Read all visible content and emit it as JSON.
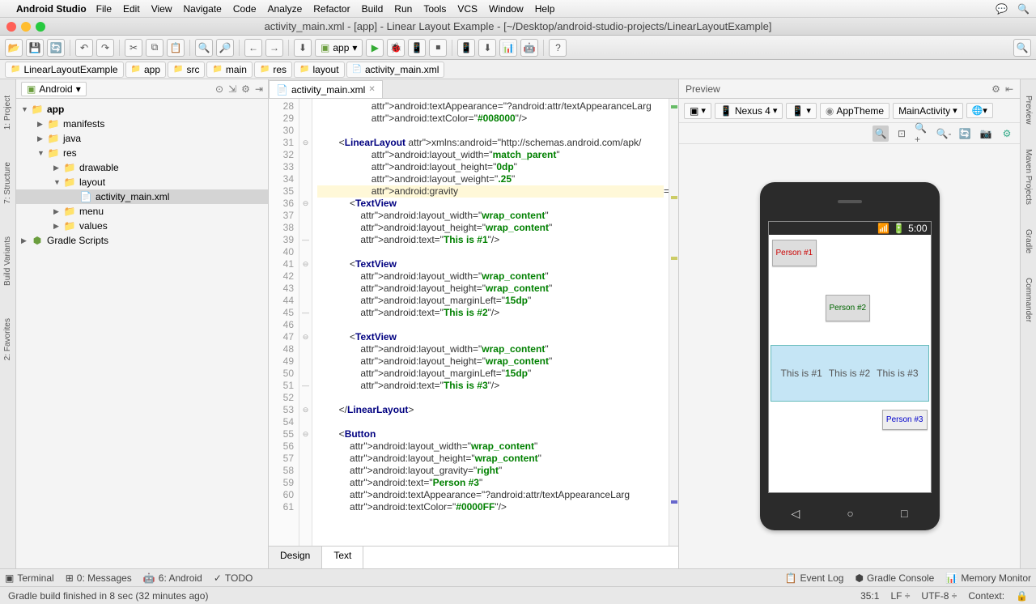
{
  "menubar": {
    "app_name": "Android Studio",
    "items": [
      "File",
      "Edit",
      "View",
      "Navigate",
      "Code",
      "Analyze",
      "Refactor",
      "Build",
      "Run",
      "Tools",
      "VCS",
      "Window",
      "Help"
    ]
  },
  "window": {
    "title": "activity_main.xml - [app] - Linear Layout Example - [~/Desktop/android-studio-projects/LinearLayoutExample]"
  },
  "run_config": {
    "label": "app"
  },
  "breadcrumbs": [
    "LinearLayoutExample",
    "app",
    "src",
    "main",
    "res",
    "layout",
    "activity_main.xml"
  ],
  "project": {
    "view_label": "Android",
    "tree": {
      "app": "app",
      "manifests": "manifests",
      "java": "java",
      "res": "res",
      "drawable": "drawable",
      "layout": "layout",
      "activity_main": "activity_main.xml",
      "menu": "menu",
      "values": "values",
      "gradle_scripts": "Gradle Scripts"
    }
  },
  "sidebar_left": {
    "project": "1: Project",
    "structure": "7: Structure",
    "build_variants": "Build Variants",
    "favorites": "2: Favorites"
  },
  "sidebar_right": {
    "preview": "Preview",
    "maven": "Maven Projects",
    "gradle": "Gradle",
    "commander": "Commander"
  },
  "editor": {
    "tab_label": "activity_main.xml",
    "first_line": 28,
    "lines": [
      "                    android:textAppearance=\"?android:attr/textAppearanceLarg",
      "                    android:textColor=\"#008000\"/>",
      "",
      "        <LinearLayout xmlns:android=\"http://schemas.android.com/apk/",
      "                    android:layout_width=\"match_parent\"",
      "                    android:layout_height=\"0dp\"",
      "                    android:layout_weight=\".25\"",
      "                    android:gravity=\"center\">",
      "            <TextView",
      "                android:layout_width=\"wrap_content\"",
      "                android:layout_height=\"wrap_content\"",
      "                android:text=\"This is #1\"/>",
      "",
      "            <TextView",
      "                android:layout_width=\"wrap_content\"",
      "                android:layout_height=\"wrap_content\"",
      "                android:layout_marginLeft=\"15dp\"",
      "                android:text=\"This is #2\"/>",
      "",
      "            <TextView",
      "                android:layout_width=\"wrap_content\"",
      "                android:layout_height=\"wrap_content\"",
      "                android:layout_marginLeft=\"15dp\"",
      "                android:text=\"This is #3\"/>",
      "",
      "        </LinearLayout>",
      "",
      "        <Button",
      "            android:layout_width=\"wrap_content\"",
      "            android:layout_height=\"wrap_content\"",
      "            android:layout_gravity=\"right\"",
      "            android:text=\"Person #3\"",
      "            android:textAppearance=\"?android:attr/textAppearanceLarg",
      "            android:textColor=\"#0000FF\"/>"
    ],
    "design_tab": "Design",
    "text_tab": "Text"
  },
  "preview": {
    "header": "Preview",
    "device": "Nexus 4",
    "theme": "AppTheme",
    "activity": "MainActivity",
    "status_time": "5:00",
    "btn1": "Person #1",
    "btn2": "Person #2",
    "btn3": "Person #3",
    "row1": "This is #1",
    "row2": "This is #2",
    "row3": "This is #3"
  },
  "bottom": {
    "terminal": "Terminal",
    "messages": "0: Messages",
    "android": "6: Android",
    "todo": "TODO",
    "event_log": "Event Log",
    "gradle_console": "Gradle Console",
    "memory": "Memory Monitor"
  },
  "status": {
    "msg": "Gradle build finished in 8 sec (32 minutes ago)",
    "pos": "35:1",
    "line_sep": "LF",
    "enc": "UTF-8",
    "context": "Context:"
  }
}
